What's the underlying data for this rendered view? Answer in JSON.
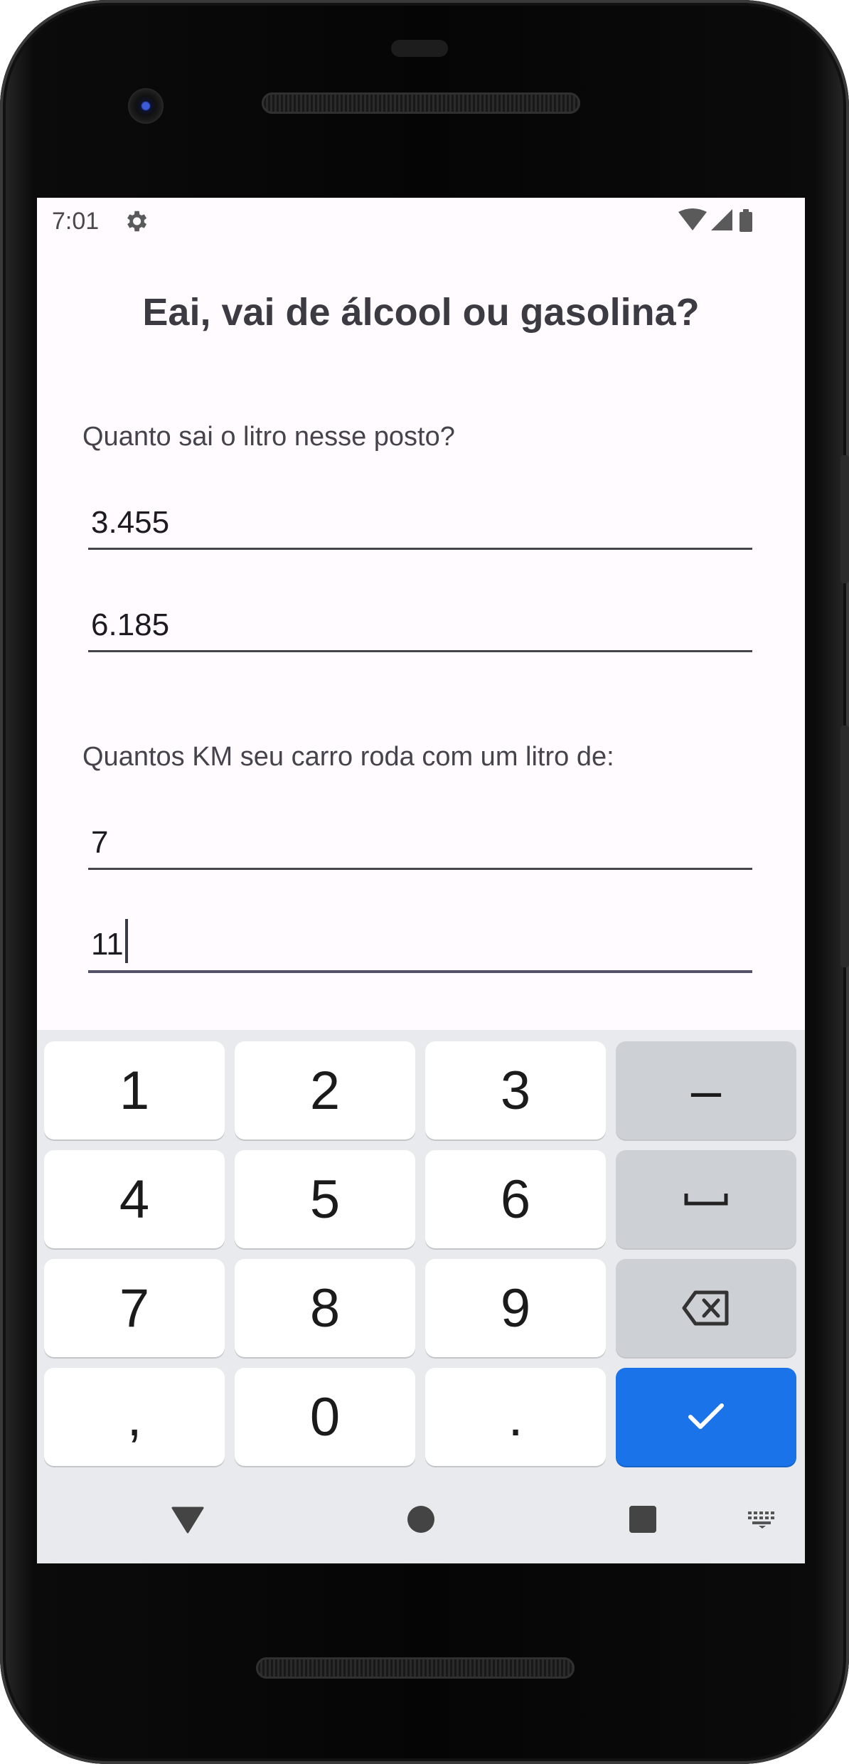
{
  "status_bar": {
    "time": "7:01",
    "icons": [
      "settings-gear-icon",
      "wifi-icon",
      "cell-signal-icon",
      "battery-icon"
    ]
  },
  "app": {
    "title": "Eai, vai de álcool ou gasolina?",
    "price_section_label": "Quanto sai o litro nesse posto?",
    "price_fields": [
      {
        "value": "3.455"
      },
      {
        "value": "6.185"
      }
    ],
    "km_section_label": "Quantos KM seu carro roda com um litro de:",
    "km_fields": [
      {
        "value": "7"
      },
      {
        "value": "11",
        "focused": true
      }
    ]
  },
  "keyboard": {
    "rows": [
      [
        "1",
        "2",
        "3",
        "–"
      ],
      [
        "4",
        "5",
        "6",
        "space-icon"
      ],
      [
        "7",
        "8",
        "9",
        "backspace-icon"
      ],
      [
        ",",
        "0",
        ".",
        "done-check-icon"
      ]
    ],
    "accent_color": "#1a73e8",
    "function_key_color": "#cdd0d5"
  },
  "navigation_bar": {
    "items": [
      "back-triangle-icon",
      "home-circle-icon",
      "recents-square-icon",
      "keyboard-switch-icon"
    ]
  },
  "colors": {
    "screen_background": "#fffbfe",
    "text_primary": "#3c3a42"
  }
}
